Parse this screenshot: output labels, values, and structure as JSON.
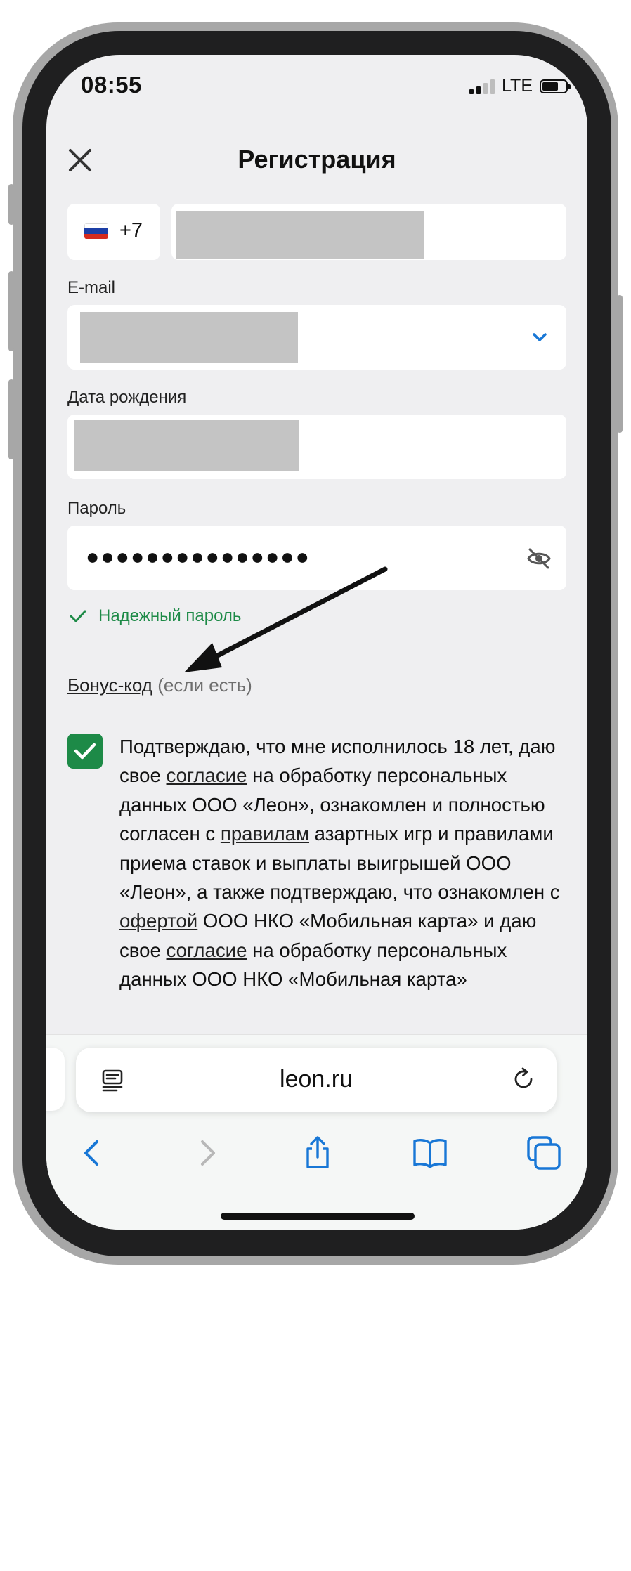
{
  "status_bar": {
    "time": "08:55",
    "network": "LTE",
    "battery_icon": "battery-icon",
    "signal_icon": "signal-bars-icon"
  },
  "header": {
    "title": "Регистрация",
    "close_icon": "close-icon"
  },
  "phone": {
    "country_flag": "russia-flag-icon",
    "dial_code": "+7"
  },
  "email": {
    "label": "E-mail",
    "dropdown_icon": "chevron-down-icon"
  },
  "birth_date": {
    "label": "Дата рождения"
  },
  "password": {
    "label": "Пароль",
    "value_masked": "●●●●●●●●●●●●●●●",
    "visibility_icon": "eye-off-icon",
    "strength_icon": "checkmark-icon",
    "strength_text": "Надежный пароль"
  },
  "bonus": {
    "link": "Бонус-код",
    "hint": " (если есть)"
  },
  "consent": {
    "checked": true,
    "t1": "Подтверждаю, что мне исполнилось 18 лет, даю свое ",
    "l1": "согласие",
    "t2": " на обработку персональных данных ООО «Леон», ознакомлен и полностью согласен с ",
    "l2": "правилам",
    "t3": " азартных игр и правилами приема ставок и выплаты выигрышей ООО «Леон», а также подтверждаю, что ознакомлен с ",
    "l3": "офертой",
    "t4": " ООО НКО «Мобильная карта» и даю свое ",
    "l4": "согласие",
    "t5": " на обработку персональных данных ООО НКО «Мобильная карта»"
  },
  "browser": {
    "url": "leon.ru",
    "reader_icon": "reader-mode-icon",
    "reload_icon": "reload-icon",
    "nav": [
      "back-icon",
      "forward-icon",
      "share-icon",
      "bookmarks-icon",
      "tabs-icon"
    ]
  },
  "colors": {
    "accent_green": "#1d8a47",
    "link_blue": "#1877d6",
    "screen_bg": "#efeff1",
    "redaction_gray": "#c4c4c4"
  }
}
